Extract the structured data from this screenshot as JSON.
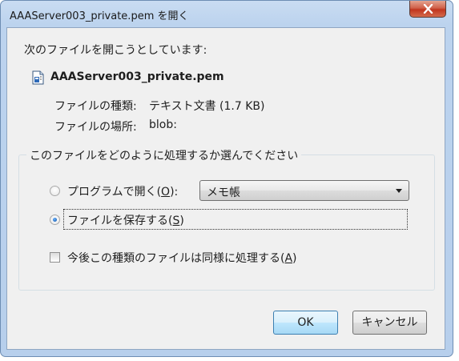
{
  "window": {
    "title": "AAAServer003_private.pem を開く"
  },
  "dialog": {
    "intro": "次のファイルを開こうとしています:",
    "file_name": "AAAServer003_private.pem",
    "file_type_label": "ファイルの種類:",
    "file_type_value": "テキスト文書 (1.7 KB)",
    "file_location_label": "ファイルの場所:",
    "file_location_value": "blob:",
    "group_title": "このファイルをどのように処理するか選んでください",
    "open_with": {
      "label": "プログラムで開く(",
      "accesskey": "O",
      "label_suffix": "):",
      "selected_program": "メモ帳",
      "checked": false
    },
    "save_file": {
      "label": "ファイルを保存する(",
      "accesskey": "S",
      "label_suffix": ")",
      "checked": true
    },
    "remember": {
      "label": "今後この種類のファイルは同様に処理する(",
      "accesskey": "A",
      "label_suffix": ")",
      "checked": false
    },
    "ok_label": "OK",
    "cancel_label": "キャンセル"
  },
  "icons": {
    "close": "close-icon",
    "file": "text-file-icon",
    "dropdown": "chevron-down-icon"
  },
  "colors": {
    "title_bar": "#bcd3ee",
    "dialog_bg": "#f0f0f0",
    "close_button": "#c1351e",
    "default_button_border": "#3c7fb1"
  }
}
